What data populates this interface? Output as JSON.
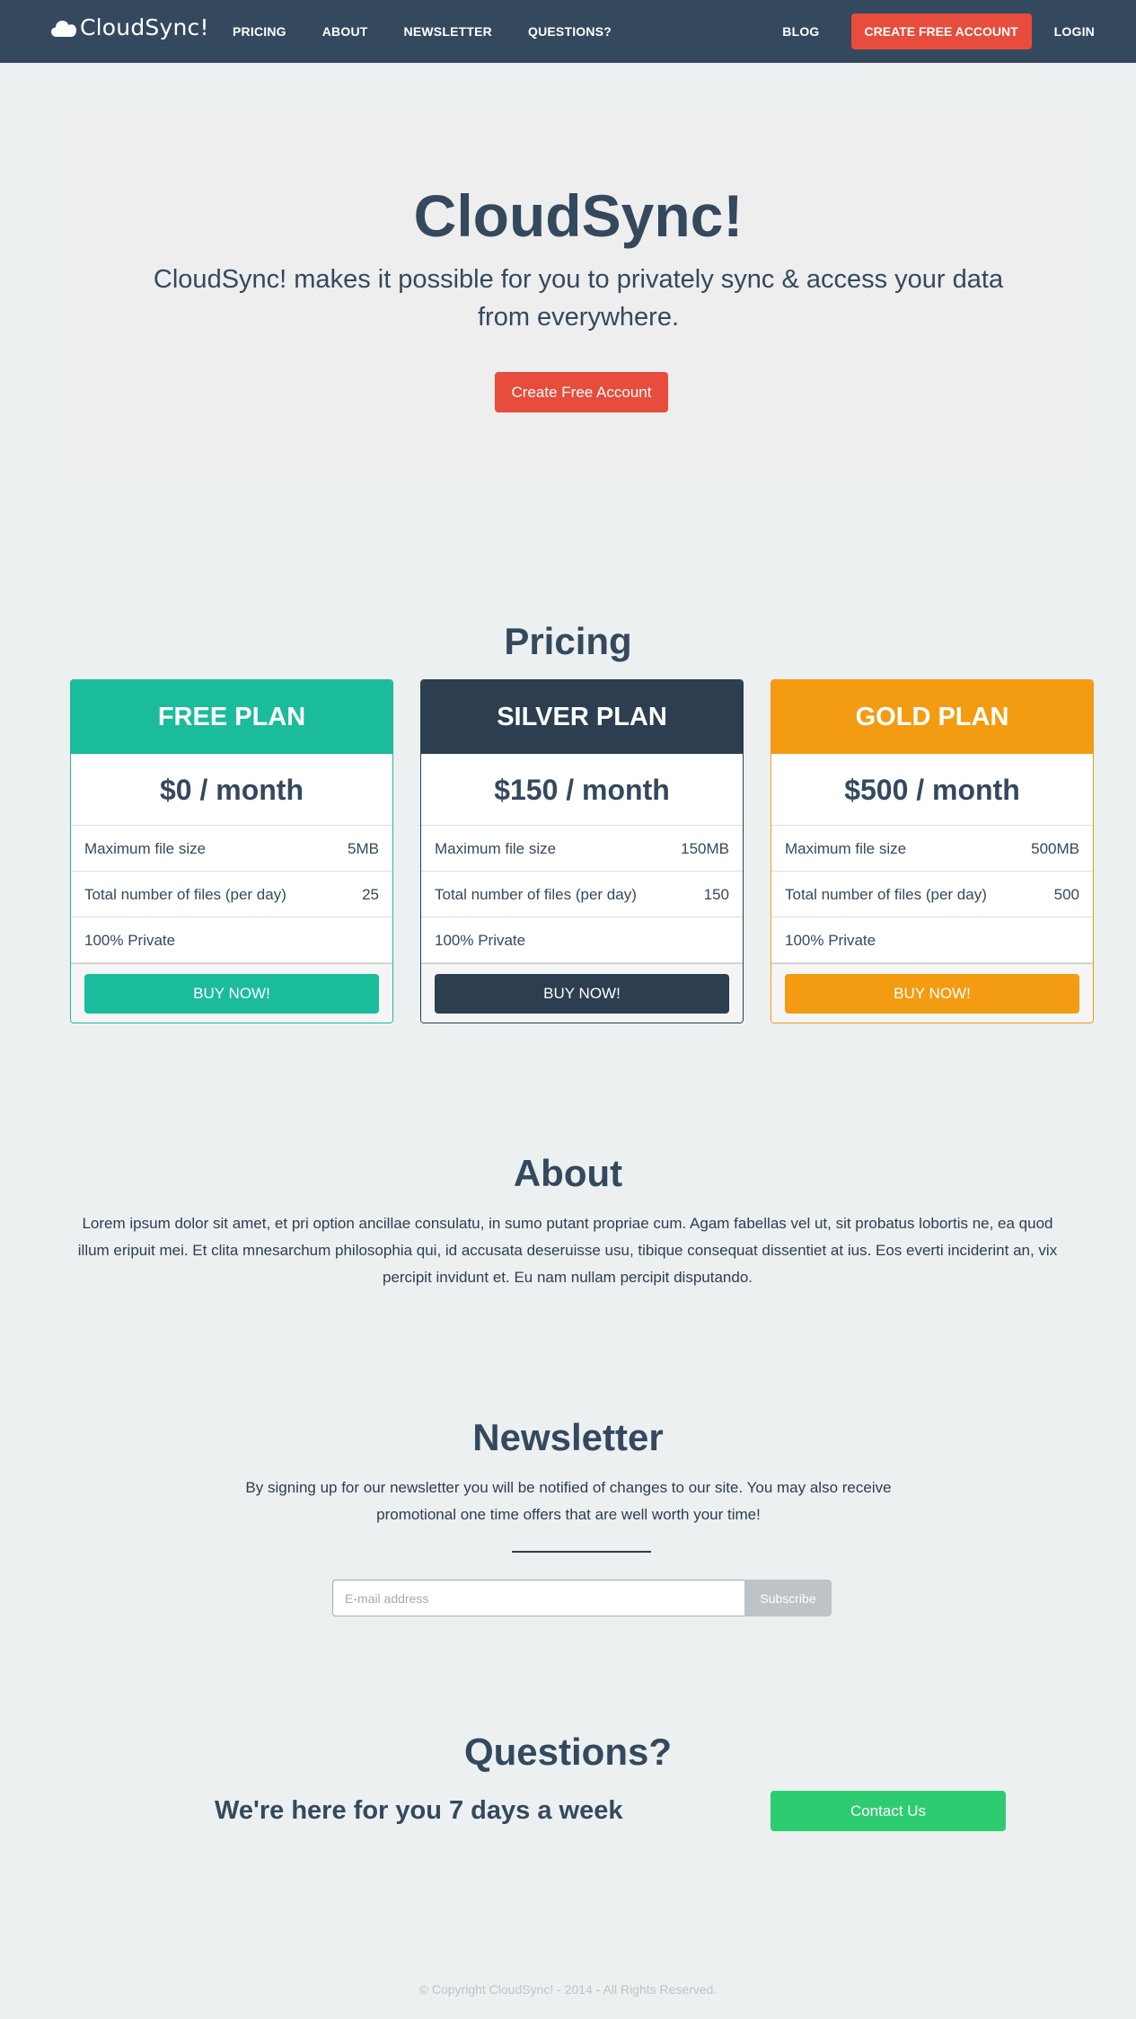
{
  "navbar": {
    "brand": "CloudSync!",
    "brand_icon": "cloud-icon",
    "links": [
      "PRICING",
      "ABOUT",
      "NEWSLETTER",
      "QUESTIONS?"
    ],
    "blog": "BLOG",
    "cta": "CREATE FREE ACCOUNT",
    "login": "LOGIN"
  },
  "hero": {
    "title": "CloudSync!",
    "subtitle": "CloudSync! makes it possible for you to privately sync & access your data from everywhere.",
    "button": "Create Free Account"
  },
  "pricing": {
    "title": "Pricing",
    "plans": [
      {
        "name": "FREE PLAN",
        "price": "$0 / month",
        "rows": [
          {
            "label": "Maximum file size",
            "value": "5MB"
          },
          {
            "label": "Total number of files (per day)",
            "value": "25"
          },
          {
            "label": "100% Private",
            "value": ""
          }
        ],
        "button": "BUY NOW!",
        "color": "#1abc9c"
      },
      {
        "name": "SILVER PLAN",
        "price": "$150 / month",
        "rows": [
          {
            "label": "Maximum file size",
            "value": "150MB"
          },
          {
            "label": "Total number of files (per day)",
            "value": "150"
          },
          {
            "label": "100% Private",
            "value": ""
          }
        ],
        "button": "BUY NOW!",
        "color": "#2c3e50"
      },
      {
        "name": "GOLD PLAN",
        "price": "$500 / month",
        "rows": [
          {
            "label": "Maximum file size",
            "value": "500MB"
          },
          {
            "label": "Total number of files (per day)",
            "value": "500"
          },
          {
            "label": "100% Private",
            "value": ""
          }
        ],
        "button": "BUY NOW!",
        "color": "#f39c12"
      }
    ]
  },
  "about": {
    "title": "About",
    "text": "Lorem ipsum dolor sit amet, et pri option ancillae consulatu, in sumo putant propriae cum. Agam fabellas vel ut, sit probatus lobortis ne, ea quod illum eripuit mei. Et clita mnesarchum philosophia qui, id accusata deseruisse usu, tibique consequat dissentiet at ius. Eos everti inciderint an, vix percipit invidunt et. Eu nam nullam percipit disputando."
  },
  "newsletter": {
    "title": "Newsletter",
    "text": "By signing up for our newsletter you will be notified of changes to our site. You may also receive promotional one time offers that are well worth your time!",
    "placeholder": "E-mail address",
    "button": "Subscribe"
  },
  "questions": {
    "title": "Questions?",
    "subtitle": "We're here for you 7 days a week",
    "button": "Contact Us"
  },
  "footer": {
    "text": "© Copyright CloudSync! - 2014 - All Rights Reserved."
  },
  "colors": {
    "navbar": "#34495e",
    "accent_red": "#e74c3c",
    "turquoise": "#1abc9c",
    "midnight": "#2c3e50",
    "orange": "#f39c12",
    "green": "#2ecc71",
    "background": "#ecf0f1"
  }
}
